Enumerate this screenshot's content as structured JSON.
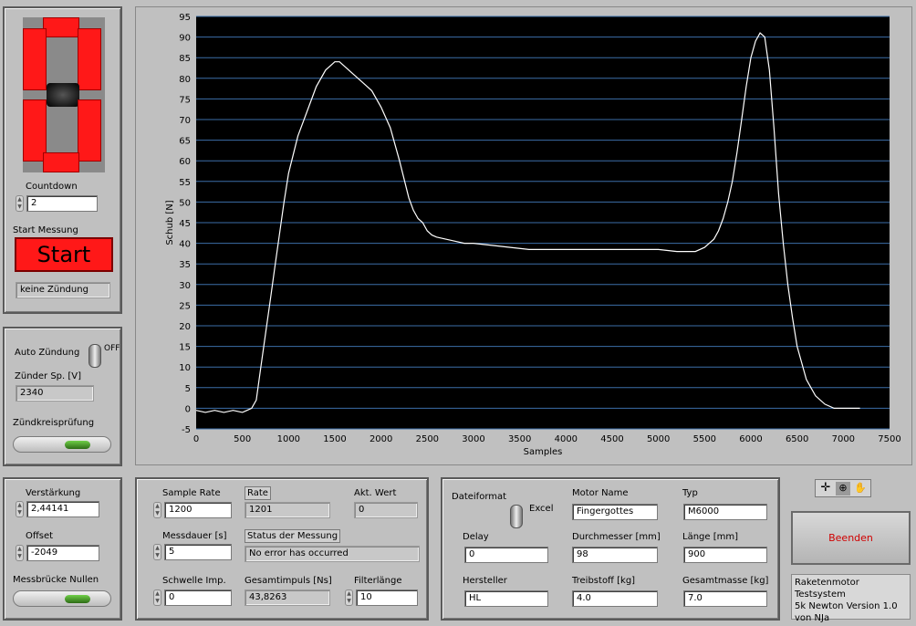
{
  "countdown": {
    "label": "Countdown",
    "value": "2",
    "start_label": "Start Messung",
    "start_button": "Start",
    "status": "keine Zündung"
  },
  "ignition": {
    "auto_label": "Auto Zündung",
    "switch_state": "OFF",
    "voltage_label": "Zünder Sp. [V]",
    "voltage_value": "2340",
    "check_label": "Zündkreisprüfung"
  },
  "amplifier": {
    "gain_label": "Verstärkung",
    "gain_value": "2,44141",
    "offset_label": "Offset",
    "offset_value": "-2049",
    "bridge_label": "Messbrücke Nullen"
  },
  "measure": {
    "sample_rate_label": "Sample Rate",
    "sample_rate_value": "1200",
    "rate_label": "Rate",
    "rate_value": "1201",
    "akt_label": "Akt. Wert",
    "akt_value": "0",
    "duration_label": "Messdauer [s]",
    "duration_value": "5",
    "status_label": "Status der Messung",
    "status_value": "No error has occurred",
    "threshold_label": "Schwelle Imp.",
    "threshold_value": "0",
    "impulse_label": "Gesamtimpuls [Ns]",
    "impulse_value": "43,8263",
    "filter_label": "Filterlänge",
    "filter_value": "10"
  },
  "motor": {
    "fileformat_label": "Dateiformat",
    "fileformat_value": "Excel",
    "name_label": "Motor Name",
    "name_value": "Fingergottes",
    "type_label": "Typ",
    "type_value": "M6000",
    "delay_label": "Delay",
    "delay_value": "0",
    "diameter_label": "Durchmesser [mm]",
    "diameter_value": "98",
    "length_label": "Länge [mm]",
    "length_value": "900",
    "maker_label": "Hersteller",
    "maker_value": "HL",
    "propellant_label": "Treibstoff [kg]",
    "propellant_value": "4.0",
    "mass_label": "Gesamtmasse [kg]",
    "mass_value": "7.0"
  },
  "exit_button": "Beenden",
  "about": [
    "Raketenmotor Testsystem",
    "5k Newton Version 1.0",
    "von NJa"
  ],
  "colors": {
    "plot_bg": "#000000",
    "trace": "#ffffff",
    "grid": "#3c6ea8",
    "start_btn": "#ff1818",
    "exit_text": "#d00000"
  },
  "chart_data": {
    "type": "line",
    "xlabel": "Samples",
    "ylabel": "Schub [N]",
    "xlim": [
      0,
      7500
    ],
    "ylim": [
      -5,
      95
    ],
    "xticks": [
      0,
      500,
      1000,
      1500,
      2000,
      2500,
      3000,
      3500,
      4000,
      4500,
      5000,
      5500,
      6000,
      6500,
      7000,
      7500
    ],
    "yticks": [
      -5,
      0,
      5,
      10,
      15,
      20,
      25,
      30,
      35,
      40,
      45,
      50,
      55,
      60,
      65,
      70,
      75,
      80,
      85,
      90,
      95
    ],
    "grid": "horizontal",
    "series": [
      {
        "x": [
          0,
          100,
          200,
          300,
          400,
          500,
          550,
          600,
          650,
          700,
          750,
          800,
          850,
          900,
          950,
          1000,
          1100,
          1200,
          1300,
          1400,
          1500,
          1550,
          1600,
          1700,
          1800,
          1900,
          2000,
          2100,
          2200,
          2300,
          2350,
          2400,
          2450,
          2500,
          2550,
          2600,
          2700,
          2800,
          2900,
          3000,
          3200,
          3400,
          3600,
          3800,
          4000,
          4200,
          4400,
          4600,
          4800,
          5000,
          5200,
          5400,
          5500,
          5550,
          5600,
          5650,
          5700,
          5750,
          5800,
          5850,
          5900,
          5950,
          6000,
          6050,
          6100,
          6150,
          6200,
          6250,
          6300,
          6350,
          6400,
          6450,
          6500,
          6600,
          6700,
          6800,
          6900,
          7000,
          7100,
          7180
        ],
        "y": [
          -0.5,
          -1,
          -0.5,
          -1,
          -0.5,
          -1,
          -0.5,
          0,
          2,
          10,
          18,
          26,
          34,
          42,
          50,
          57,
          66,
          72,
          78,
          82,
          84,
          84,
          83,
          81,
          79,
          77,
          73,
          68,
          60,
          51,
          48,
          46,
          45,
          43,
          42,
          41.5,
          41,
          40.5,
          40,
          40,
          39.5,
          39,
          38.5,
          38.5,
          38.5,
          38.5,
          38.5,
          38.5,
          38.5,
          38.5,
          38,
          38,
          39,
          40,
          41,
          43,
          46,
          50,
          55,
          62,
          70,
          78,
          85,
          89,
          91,
          90,
          82,
          68,
          52,
          40,
          30,
          22,
          15,
          7,
          3,
          1,
          0,
          0,
          0,
          0
        ]
      }
    ]
  }
}
